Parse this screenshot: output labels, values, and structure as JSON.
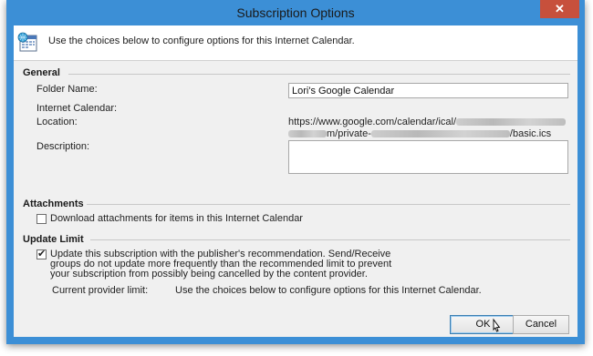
{
  "window": {
    "title": "Subscription Options",
    "close_glyph": "✕"
  },
  "header": {
    "icon": "calendar-icon",
    "text": "Use the choices below to configure options for this Internet Calendar."
  },
  "general": {
    "heading": "General",
    "folder_name_label": "Folder Name:",
    "folder_name_value": "Lori's Google Calendar",
    "internet_calendar_label": "Internet Calendar:",
    "location_label": "Location:",
    "location_line1": "https://www.google.com/calendar/ical/",
    "location_line2_mid": "m/private-",
    "location_line2_end": "/basic.ics",
    "description_label": "Description:",
    "description_value": ""
  },
  "attachments": {
    "heading": "Attachments",
    "download_label": "Download attachments for items in this Internet Calendar",
    "download_checked": false
  },
  "update_limit": {
    "heading": "Update Limit",
    "update_label_line1": "Update this subscription with the publisher's recommendation. Send/Receive",
    "update_label_line2": "groups do not update more frequently than the recommended limit to prevent",
    "update_label_line3": "your subscription from possibly being cancelled by the content provider.",
    "update_checked": true,
    "current_limit_label": "Current provider limit:",
    "current_limit_value": "Use the choices below to configure options for this Internet Calendar."
  },
  "buttons": {
    "ok": "OK",
    "cancel": "Cancel"
  },
  "colors": {
    "title_bar": "#3c8fd6",
    "close_button": "#c7503c",
    "dialog_bg": "#f0f0f0"
  }
}
